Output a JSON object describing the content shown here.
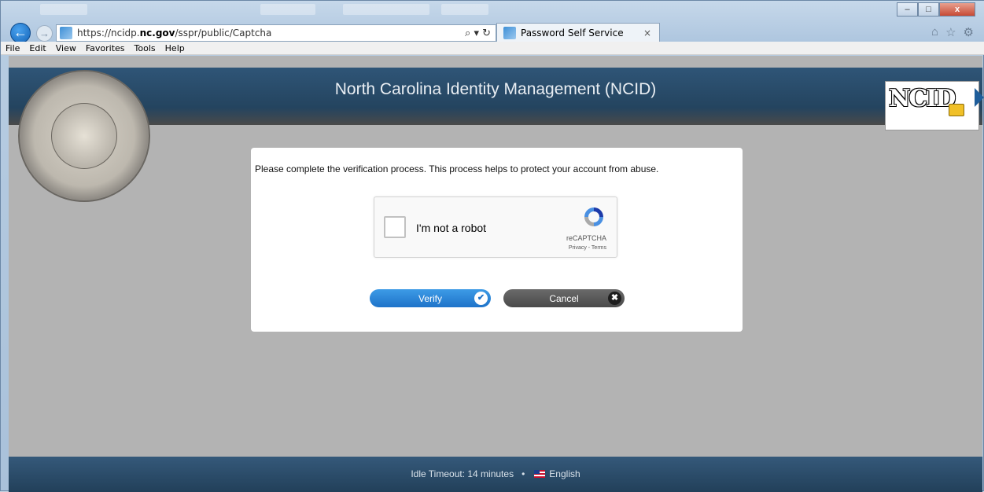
{
  "browser": {
    "address_url_prefix": "https://ncidp.",
    "address_url_host": "nc.gov",
    "address_url_path": "/sspr/public/Captcha",
    "search_refresh_glyph": "⌕ ▾ ↻",
    "tab_title": "Password Self Service",
    "tab_close": "×",
    "window_controls": {
      "minimize": "–",
      "maximize": "□",
      "close": "x"
    },
    "back_glyph": "←",
    "forward_glyph": "→",
    "right_icons": [
      "home-icon",
      "star-icon",
      "gear-icon"
    ],
    "home_glyph": "⌂",
    "star_glyph": "☆",
    "gear_glyph": "⚙"
  },
  "menu": {
    "file": "File",
    "edit": "Edit",
    "view": "View",
    "favorites": "Favorites",
    "tools": "Tools",
    "help": "Help"
  },
  "header": {
    "title": "North Carolina Identity Management (NCID)",
    "logo_text": "NCID"
  },
  "dialog": {
    "message": "Please complete the verification process. This process helps to protect your account from abuse.",
    "recaptcha": {
      "label": "I'm not a robot",
      "brand": "reCAPTCHA",
      "links": "Privacy - Terms"
    },
    "verify_label": "Verify",
    "cancel_label": "Cancel",
    "verify_icon_glyph": "✔",
    "cancel_icon_glyph": "✖"
  },
  "footer": {
    "idle_timeout": "Idle Timeout: 14 minutes",
    "separator": "•",
    "language": "English"
  },
  "colors": {
    "header_bg": "#2f5577",
    "verify_button": "#1e73c9",
    "cancel_button": "#4a4a4a",
    "page_bg": "#b3b3b3"
  }
}
